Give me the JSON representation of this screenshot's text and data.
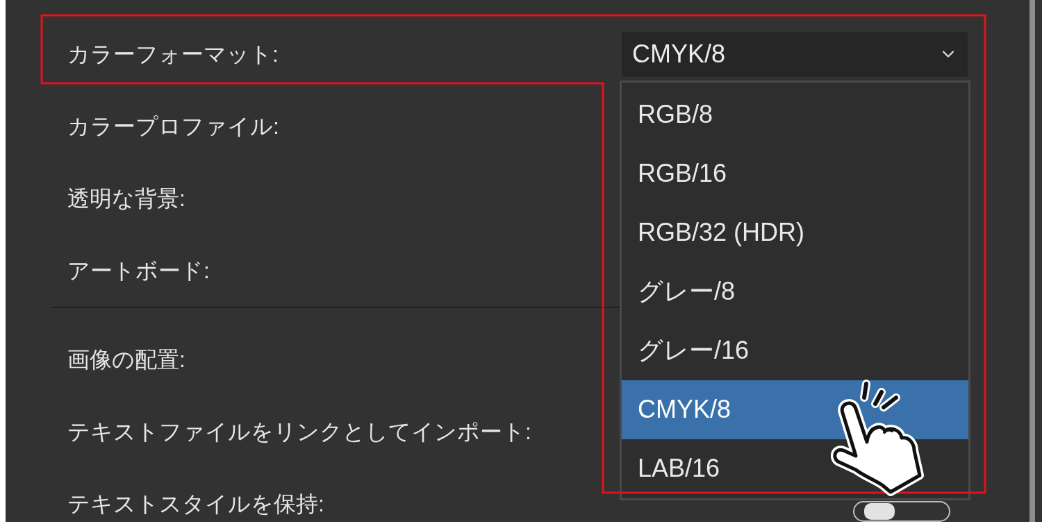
{
  "sections": [
    {
      "rows": [
        {
          "kind": "select",
          "label": "カラーフォーマット:",
          "value": "CMYK/8",
          "expanded": true,
          "options": [
            {
              "label": "RGB/8",
              "selected": false
            },
            {
              "label": "RGB/16",
              "selected": false
            },
            {
              "label": "RGB/32 (HDR)",
              "selected": false
            },
            {
              "label": "グレー/8",
              "selected": false
            },
            {
              "label": "グレー/16",
              "selected": false
            },
            {
              "label": "CMYK/8",
              "selected": true
            },
            {
              "label": "LAB/16",
              "selected": false
            }
          ]
        },
        {
          "kind": "label",
          "label": "カラープロファイル:"
        },
        {
          "kind": "label",
          "label": "透明な背景:"
        },
        {
          "kind": "label",
          "label": "アートボード:"
        }
      ]
    },
    {
      "rows": [
        {
          "kind": "label",
          "label": "画像の配置:"
        },
        {
          "kind": "label",
          "label": "テキストファイルをリンクとしてインポート:"
        },
        {
          "kind": "toggle",
          "label": "テキストスタイルを保持:",
          "on": false
        }
      ]
    }
  ]
}
